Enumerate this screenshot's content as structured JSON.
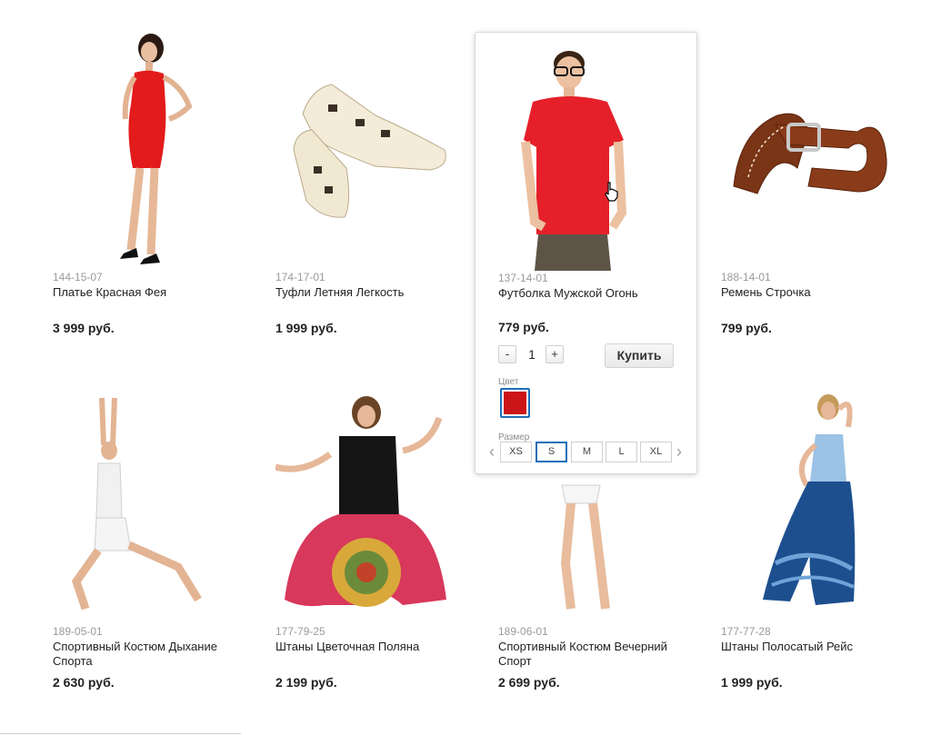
{
  "products": [
    {
      "sku": "144-15-07",
      "name": "Платье Красная Фея",
      "price": "3 999 руб.",
      "image": "woman-red-dress-photo"
    },
    {
      "sku": "174-17-01",
      "name": "Туфли Летняя Легкость",
      "price": "1 999 руб.",
      "image": "white-summer-shoes-photo"
    },
    {
      "sku": "137-14-01",
      "name": "Футболка Мужской Огонь",
      "price": "779 руб.",
      "image": "man-red-tshirt-photo"
    },
    {
      "sku": "188-14-01",
      "name": "Ремень Строчка",
      "price": "799 руб.",
      "image": "brown-leather-belt-photo"
    },
    {
      "sku": "189-05-01",
      "name": "Спортивный Костюм Дыхание Спорта",
      "price": "2 630 руб.",
      "image": "woman-sport-suit-yoga-photo"
    },
    {
      "sku": "177-79-25",
      "name": "Штаны Цветочная Поляна",
      "price": "2 199 руб.",
      "image": "woman-floral-harem-pants-photo"
    },
    {
      "sku": "189-06-01",
      "name": "Спортивный Костюм Вечерний Спорт",
      "price": "2 699 руб.",
      "image": "woman-sport-suit-photo"
    },
    {
      "sku": "177-77-28",
      "name": "Штаны Полосатый Рейс",
      "price": "1 999 руб.",
      "image": "woman-blue-tiedye-pants-photo"
    }
  ],
  "quick_view": {
    "qty_minus": "-",
    "qty_value": "1",
    "qty_plus": "+",
    "buy_label": "Купить",
    "color_label": "Цвет",
    "selected_color": "#cc1518",
    "size_label": "Размер",
    "sizes": [
      "XS",
      "S",
      "M",
      "L",
      "XL"
    ],
    "selected_size": "S",
    "prev_arrow": "‹",
    "next_arrow": "›"
  },
  "icons": {
    "cursor": "hand-pointer-icon",
    "prev": "chevron-left-icon",
    "next": "chevron-right-icon"
  }
}
